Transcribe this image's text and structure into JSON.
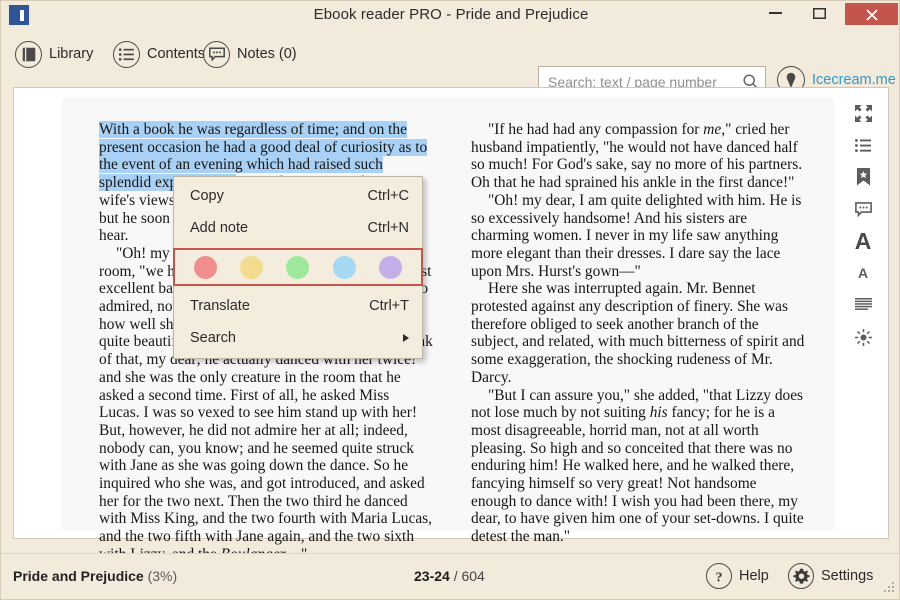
{
  "window": {
    "title": "Ebook reader PRO - Pride and Prejudice",
    "app_icon": "book-app-icon",
    "minimize_icon": "minimize-icon",
    "maximize_icon": "maximize-icon",
    "close_icon": "close-icon",
    "close_color": "#c4554d"
  },
  "toolbar": {
    "library_label": "Library",
    "library_icon": "book-icon",
    "contents_label": "Contents",
    "contents_icon": "list-icon",
    "notes_label": "Notes (0)",
    "notes_icon": "speech-bubble-icon",
    "brand_label": "Icecream.me",
    "brand_icon": "icecream-cone-icon",
    "brand_color": "#3399cc"
  },
  "search": {
    "placeholder": "Search: text / page number",
    "value": "",
    "icon": "magnifier-icon"
  },
  "reader": {
    "left_column": {
      "p1_highlight": "With a book he was regardless of time; and on the present occasion he had a good deal of curiosity as to the event of an evening which had raised such splendid expectations.",
      "p1_rest": " He had rather hoped that his wife's views on the stranger would be disappointed; but he soon found out that he had a different story to hear.",
      "p2_a": "\"Oh! my dear Mr. Bennet,\" as she entered the room, \"we have had a most delightful evening, a most excellent ball. I wish you had been there. Jane was so admired, nothing could be like it. Everybody said how well she looked; and Mr. Bingley thought her quite beautiful, and danced with her twice! Only think of ",
      "p2_b": "that, my dear; he actually danced with her twice! and she was the only creature in the room that he asked a second time. First of all, he asked Miss Lucas. I was so vexed to see him stand up with her! But, however, he did not admire her at all; indeed, nobody can, you know; and he seemed quite struck with Jane as she was going down the dance. So he inquired who she was, and got introduced, and asked her for the two next. Then the two third he danced with Miss King, and the two fourth with Maria Lucas, and the two fifth with Jane again, and the two sixth with Lizzy, and the ",
      "p2_italic": "Boulanger",
      "p2_end": "—\"",
      "highlight_color": "#a8d1f5"
    },
    "right_column": {
      "p1_a": "\"If he had had any compassion for ",
      "p1_italic": "me",
      "p1_b": ",\" cried her husband impatiently, \"he would not have danced half so much! For God's sake, say no more of his partners. Oh that he had sprained his ankle in the first dance!\"",
      "p2": "\"Oh! my dear, I am quite delighted with him. He is so excessively handsome! And his sisters are charming women. I never in my life saw anything more elegant than their dresses. I dare say the lace upon Mrs. Hurst's gown—\"",
      "p3": "Here she was interrupted again. Mr. Bennet protested against any description of finery. She was therefore obliged to seek another branch of the subject, and related, with much bitterness of spirit and some exaggeration, the shocking rudeness of Mr. Darcy.",
      "p4_a": "\"But I can assure you,\" she added, \"that Lizzy does not lose much by not suiting ",
      "p4_italic": "his",
      "p4_b": " fancy; for he is a most disagreeable, horrid man, not at all worth pleasing. So high and so conceited that there was no enduring him! He walked here, and he walked there, fancying himself so very great! Not handsome enough to dance with! I wish you had been there, my dear, to have given him one of your set-downs. I quite detest the man.\""
    }
  },
  "rail": {
    "items": [
      {
        "icon": "fullscreen-icon"
      },
      {
        "icon": "list-lines-icon"
      },
      {
        "icon": "bookmark-icon"
      },
      {
        "icon": "note-bubble-icon"
      },
      {
        "icon": "font-increase-icon",
        "glyph": "A"
      },
      {
        "icon": "font-decrease-icon",
        "glyph": "A"
      },
      {
        "icon": "line-spacing-icon"
      },
      {
        "icon": "brightness-icon"
      }
    ]
  },
  "context_menu": {
    "items": [
      {
        "label": "Copy",
        "shortcut": "Ctrl+C",
        "name": "copy"
      },
      {
        "label": "Add note",
        "shortcut": "Ctrl+N",
        "name": "add-note"
      },
      {
        "label": "Translate",
        "shortcut": "Ctrl+T",
        "name": "translate"
      },
      {
        "label": "Search",
        "shortcut": "",
        "name": "search",
        "submenu": true
      }
    ],
    "colors": [
      {
        "name": "red-highlight",
        "hex": "#f08e8e"
      },
      {
        "name": "yellow-highlight",
        "hex": "#f2dd8e"
      },
      {
        "name": "green-highlight",
        "hex": "#9ee89b"
      },
      {
        "name": "blue-highlight",
        "hex": "#a5d8f2"
      },
      {
        "name": "purple-highlight",
        "hex": "#c5aee8"
      }
    ],
    "border_color": "#c4554d"
  },
  "statusbar": {
    "book_title": "Pride and Prejudice",
    "progress": "(3%)",
    "current_pages": "23-24",
    "page_separator": " / ",
    "total_pages": "604",
    "help_label": "Help",
    "help_icon": "question-mark-icon",
    "settings_label": "Settings",
    "settings_icon": "gear-icon"
  }
}
